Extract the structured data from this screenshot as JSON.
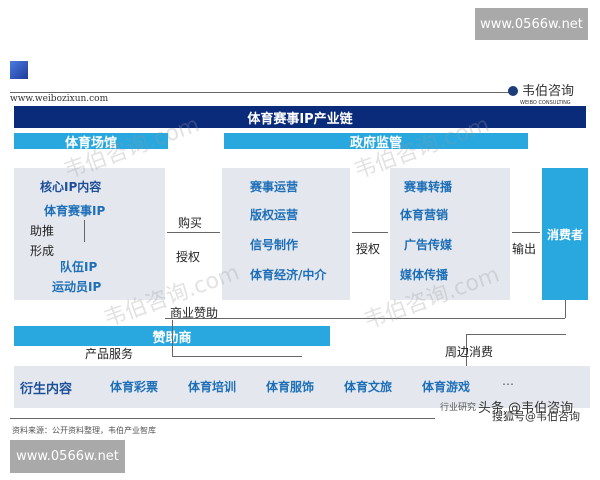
{
  "watermark_top": "www.0566w.net",
  "watermark_bottom": "www.0566w.net",
  "site_url": "www.weibozixun.com",
  "logo": {
    "name": "韦伯咨询",
    "sub": "WEIBO CONSULTING"
  },
  "title": "体育赛事IP产业链",
  "venue_label": "体育场馆",
  "gov_label": "政府监管",
  "left_box": {
    "items": [
      "核心IP内容",
      "体育赛事IP",
      "助推",
      "形成",
      "队伍IP",
      "运动员IP"
    ]
  },
  "middle_box": {
    "items": [
      "赛事运营",
      "版权运营",
      "信号制作",
      "体育经济/中介"
    ]
  },
  "right_box": {
    "items": [
      "赛事转播",
      "体育营销",
      "广告传媒",
      "媒体传播"
    ]
  },
  "consumer": "消费者",
  "arrows": {
    "buy": "购买",
    "license1": "授权",
    "license2": "授权",
    "output": "输出",
    "sponsorship": "商业赞助",
    "product_service": "产品服务",
    "peripheral": "周边消费"
  },
  "sponsor": "赞助商",
  "derivative": {
    "label": "衍生内容",
    "items": [
      "体育彩票",
      "体育培训",
      "体育服饰",
      "体育文旅",
      "体育游戏",
      "…"
    ]
  },
  "source": "资料来源：公开资料整理，韦伯产业智库",
  "footer_right": "行业研究",
  "overlay": {
    "toutiao": "头条 @韦伯咨询",
    "sohu": "搜狐号@韦伯咨询"
  },
  "faint_mark": "韦伯咨询.com"
}
